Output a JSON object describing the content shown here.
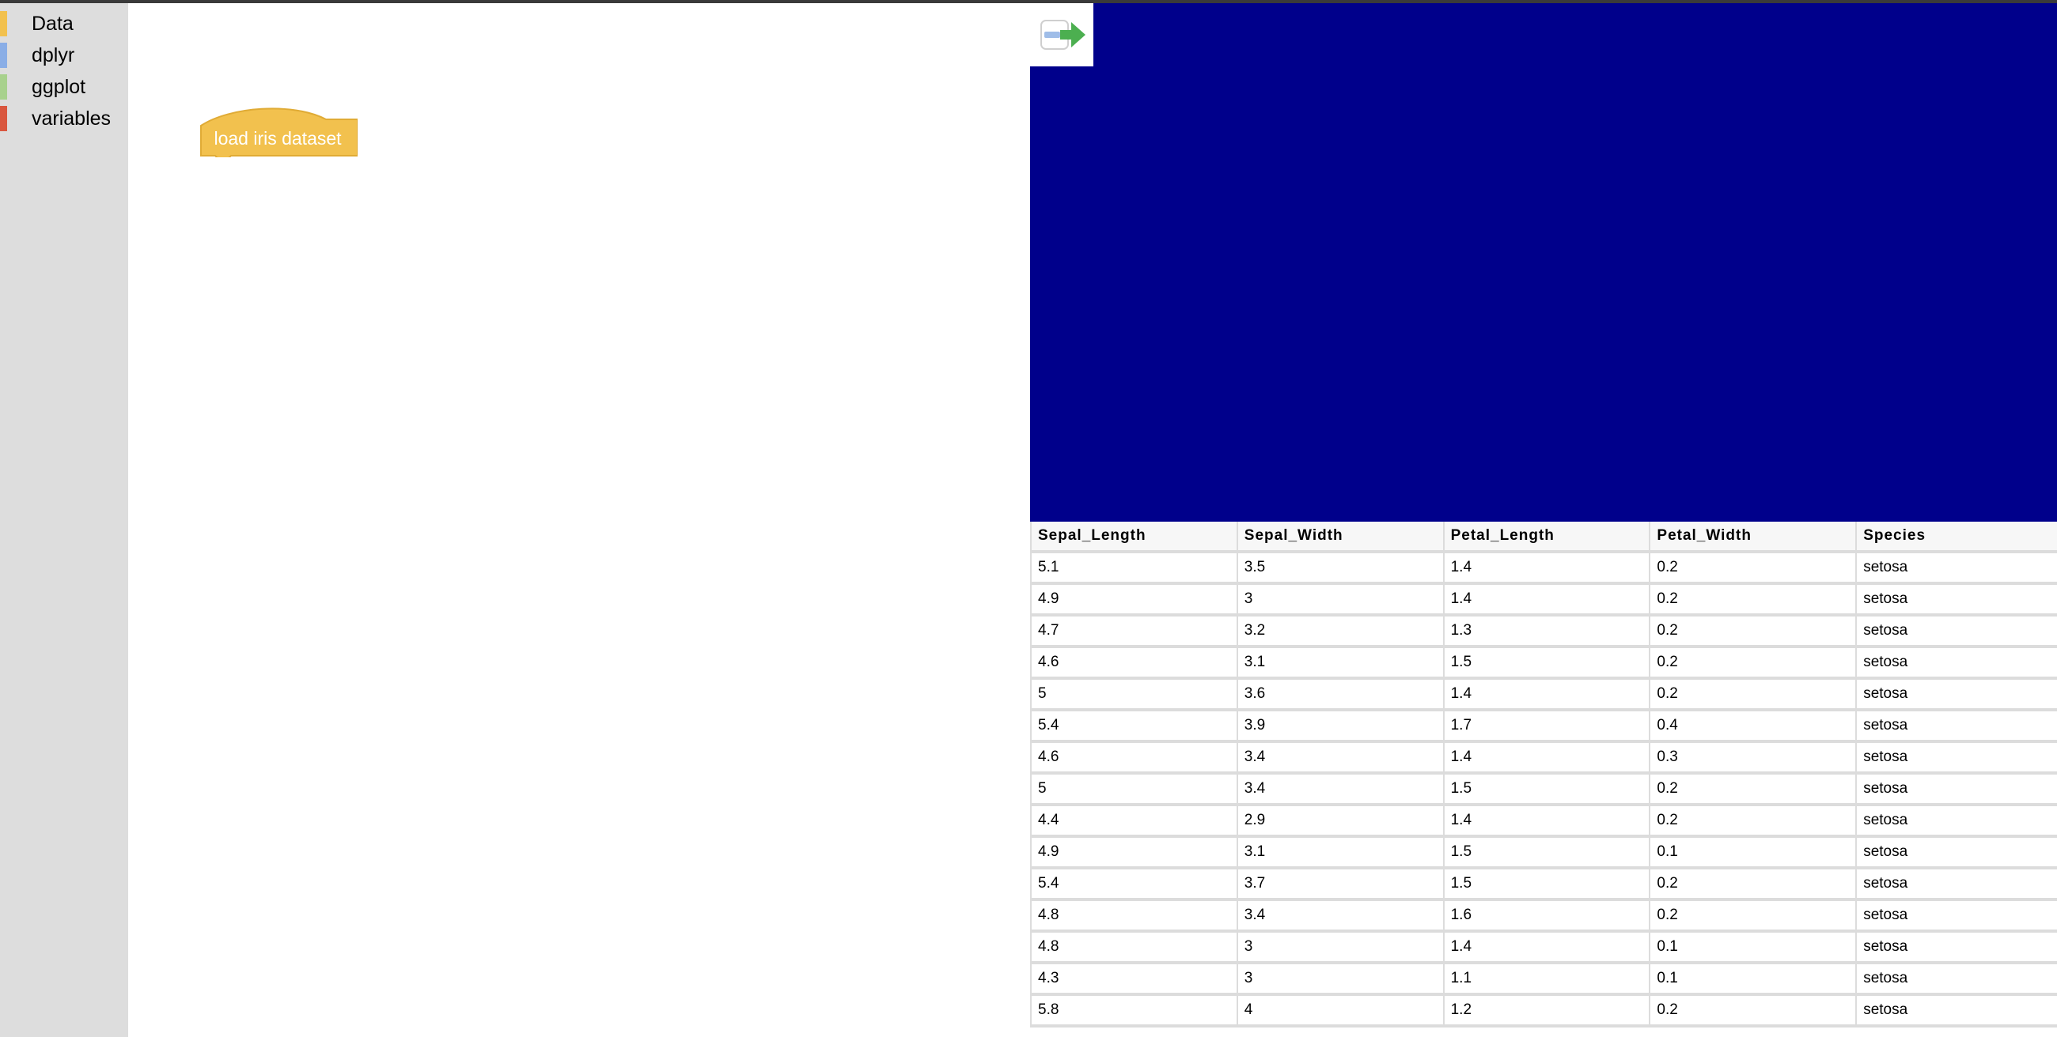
{
  "toolbox": {
    "categories": [
      {
        "label": "Data",
        "color": "#f2c14e"
      },
      {
        "label": "dplyr",
        "color": "#8aaee6"
      },
      {
        "label": "ggplot",
        "color": "#a8d18d"
      },
      {
        "label": "variables",
        "color": "#d9573f"
      }
    ]
  },
  "workspace": {
    "block": {
      "label": "load iris dataset",
      "color": "#f2c14e"
    },
    "trash_icon": "trash-icon"
  },
  "output": {
    "canvas_color": "#00008b",
    "run_icon": "run-arrow-icon",
    "table": {
      "columns": [
        "Sepal_Length",
        "Sepal_Width",
        "Petal_Length",
        "Petal_Width",
        "Species"
      ],
      "rows": [
        [
          "5.1",
          "3.5",
          "1.4",
          "0.2",
          "setosa"
        ],
        [
          "4.9",
          "3",
          "1.4",
          "0.2",
          "setosa"
        ],
        [
          "4.7",
          "3.2",
          "1.3",
          "0.2",
          "setosa"
        ],
        [
          "4.6",
          "3.1",
          "1.5",
          "0.2",
          "setosa"
        ],
        [
          "5",
          "3.6",
          "1.4",
          "0.2",
          "setosa"
        ],
        [
          "5.4",
          "3.9",
          "1.7",
          "0.4",
          "setosa"
        ],
        [
          "4.6",
          "3.4",
          "1.4",
          "0.3",
          "setosa"
        ],
        [
          "5",
          "3.4",
          "1.5",
          "0.2",
          "setosa"
        ],
        [
          "4.4",
          "2.9",
          "1.4",
          "0.2",
          "setosa"
        ],
        [
          "4.9",
          "3.1",
          "1.5",
          "0.1",
          "setosa"
        ],
        [
          "5.4",
          "3.7",
          "1.5",
          "0.2",
          "setosa"
        ],
        [
          "4.8",
          "3.4",
          "1.6",
          "0.2",
          "setosa"
        ],
        [
          "4.8",
          "3",
          "1.4",
          "0.1",
          "setosa"
        ],
        [
          "4.3",
          "3",
          "1.1",
          "0.1",
          "setosa"
        ],
        [
          "5.8",
          "4",
          "1.2",
          "0.2",
          "setosa"
        ]
      ]
    }
  }
}
